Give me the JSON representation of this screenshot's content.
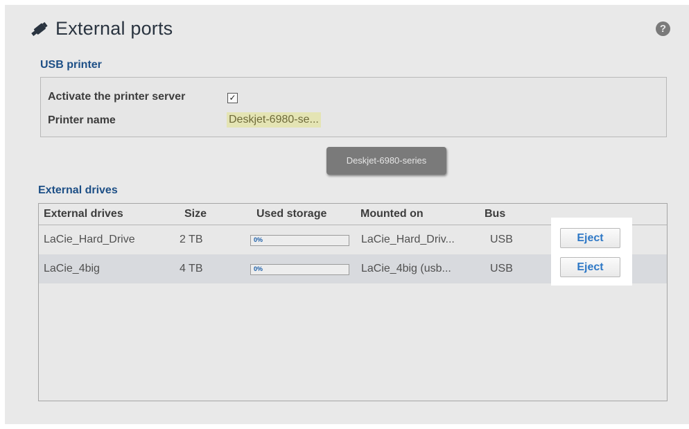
{
  "page": {
    "title": "External ports",
    "icon": "usb-plug-icon",
    "help_icon": "help-icon",
    "help_glyph": "?"
  },
  "usb_printer": {
    "section_title": "USB printer",
    "activate_label": "Activate the printer server",
    "activate_checked": true,
    "checkbox_glyph": "✓",
    "printer_name_label": "Printer name",
    "printer_name_value": "Deskjet-6980-se...",
    "tooltip": "Deskjet-6980-series"
  },
  "external_drives": {
    "section_title": "External drives",
    "columns": [
      "External drives",
      "Size",
      "Used storage",
      "Mounted on",
      "Bus"
    ],
    "rows": [
      {
        "name": "LaCie_Hard_Drive",
        "size": "2 TB",
        "used_storage_label": "0%",
        "used_fraction": 0,
        "mounted_on": "LaCie_Hard_Driv...",
        "bus": "USB",
        "action": "Eject"
      },
      {
        "name": "LaCie_4big",
        "size": "4 TB",
        "used_storage_label": "0%",
        "used_fraction": 0,
        "mounted_on": "LaCie_4big (usb...",
        "bus": "USB",
        "action": "Eject"
      }
    ]
  },
  "colors": {
    "background": "#e9e9e9",
    "section_title": "#1d4f86",
    "button_text": "#2e78c6",
    "tooltip_bg": "#7a7a7a",
    "printer_highlight": "#e4e4b4"
  }
}
